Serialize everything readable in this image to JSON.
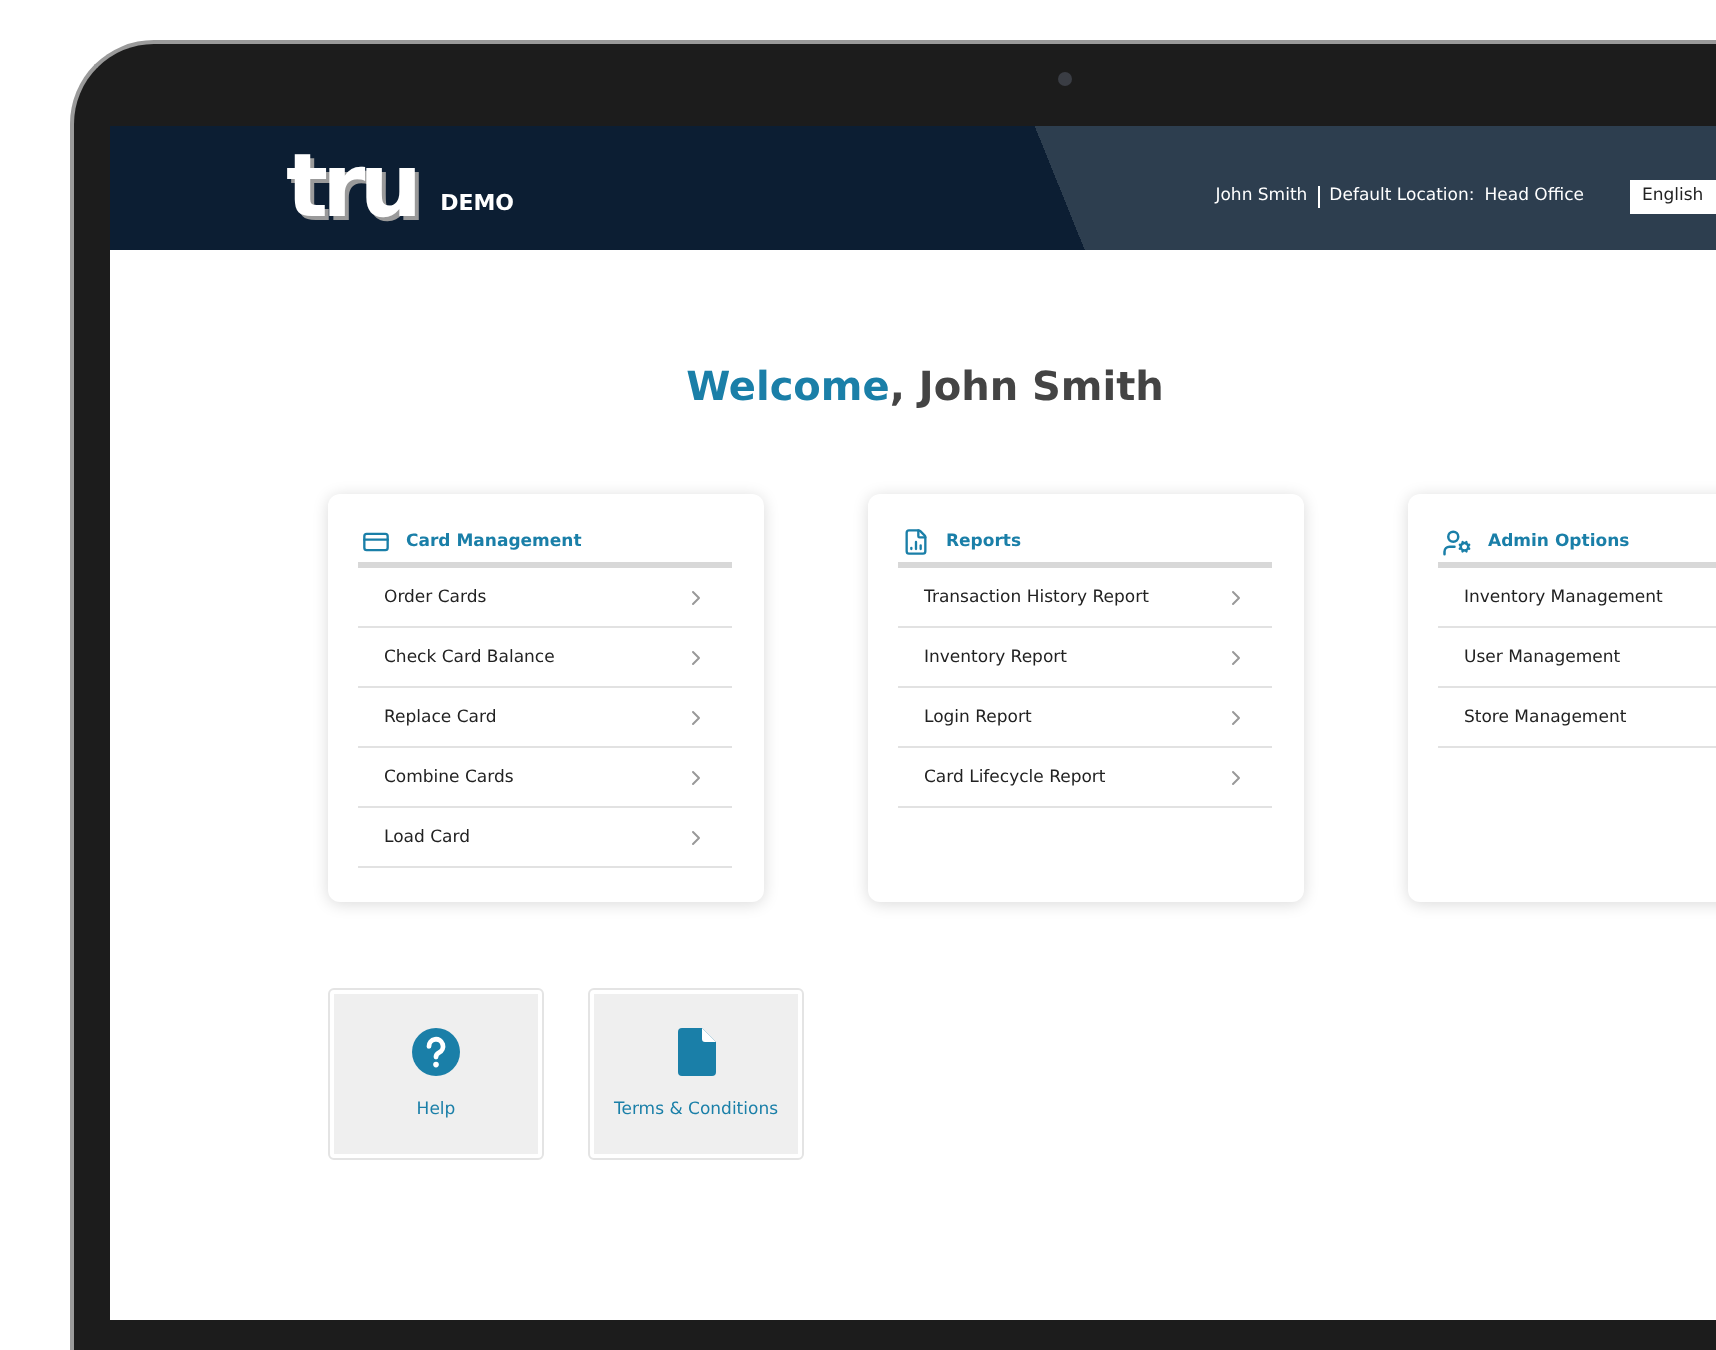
{
  "header": {
    "logo": "tru",
    "badge": "DEMO",
    "user": "John Smith",
    "location_label": "Default Location:",
    "location": "Head Office",
    "language": "English"
  },
  "welcome": {
    "highlight": "Welcome",
    "rest": ", John Smith"
  },
  "cards": [
    {
      "kind": "card",
      "title": "Card Management",
      "items": [
        "Order Cards",
        "Check Card Balance",
        "Replace Card",
        "Combine Cards",
        "Load Card"
      ]
    },
    {
      "kind": "reports",
      "title": "Reports",
      "items": [
        "Transaction History Report",
        "Inventory Report",
        "Login Report",
        "Card Lifecycle Report"
      ]
    },
    {
      "kind": "admin",
      "title": "Admin Options",
      "items": [
        "Inventory Management",
        "User Management",
        "Store Management"
      ]
    }
  ],
  "tiles": [
    {
      "kind": "help",
      "label": "Help"
    },
    {
      "kind": "document",
      "label": "Terms & Conditions"
    }
  ]
}
